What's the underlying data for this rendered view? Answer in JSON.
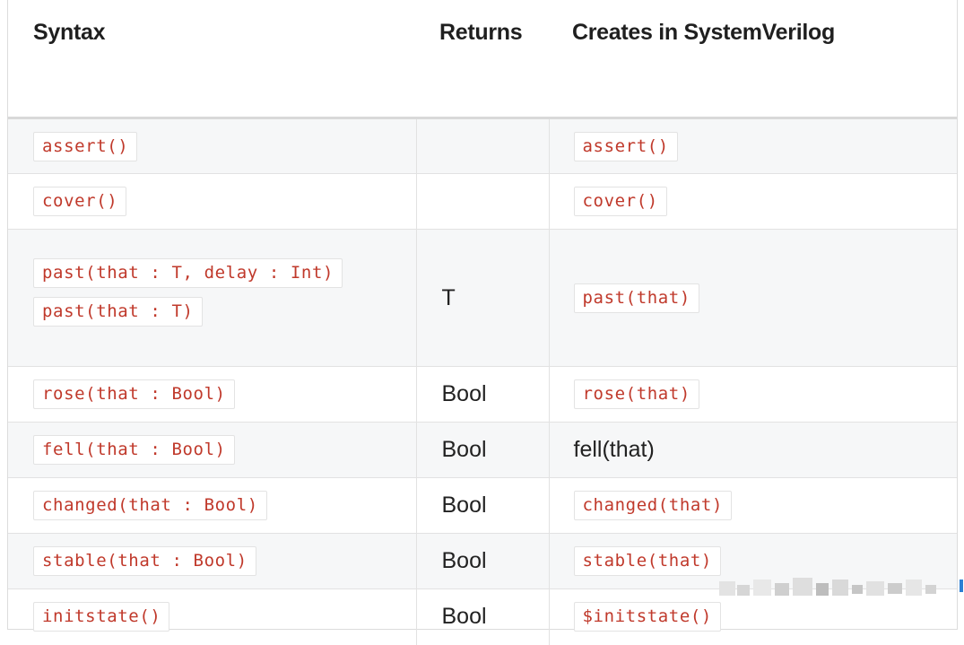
{
  "table": {
    "headers": [
      "Syntax",
      "Returns",
      "Creates in SystemVerilog"
    ],
    "rows": [
      {
        "syntax": [
          "assert()"
        ],
        "returns": "",
        "creates": "assert()",
        "creates_code": true
      },
      {
        "syntax": [
          "cover()"
        ],
        "returns": "",
        "creates": "cover()",
        "creates_code": true
      },
      {
        "syntax": [
          "past(that : T, delay : Int)",
          "past(that : T)"
        ],
        "returns": "T",
        "creates": "past(that)",
        "creates_code": true
      },
      {
        "syntax": [
          "rose(that : Bool)"
        ],
        "returns": "Bool",
        "creates": "rose(that)",
        "creates_code": true
      },
      {
        "syntax": [
          "fell(that : Bool)"
        ],
        "returns": "Bool",
        "creates": "fell(that)",
        "creates_code": false
      },
      {
        "syntax": [
          "changed(that : Bool)"
        ],
        "returns": "Bool",
        "creates": "changed(that)",
        "creates_code": true
      },
      {
        "syntax": [
          "stable(that : Bool)"
        ],
        "returns": "Bool",
        "creates": "stable(that)",
        "creates_code": true
      },
      {
        "syntax": [
          "initstate()"
        ],
        "returns": "Bool",
        "creates": "$initstate()",
        "creates_code": true
      }
    ]
  },
  "colors": {
    "code_text": "#c0392b",
    "shade": "#f6f7f8",
    "border": "#e2e2e2"
  }
}
